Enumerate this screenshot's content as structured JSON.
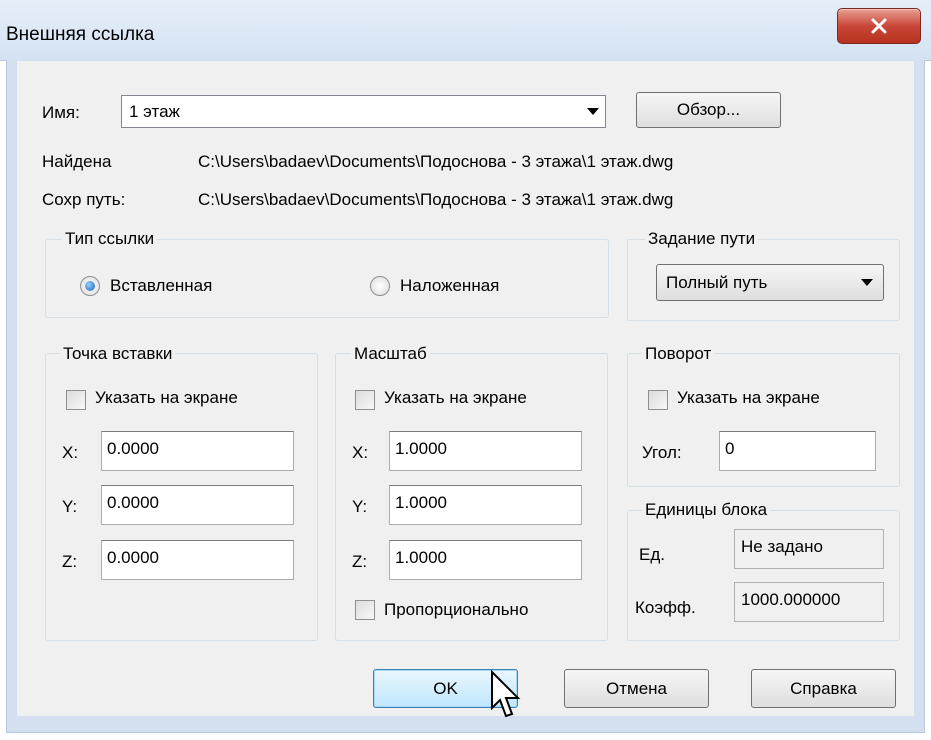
{
  "window": {
    "title": "Внешняя ссылка"
  },
  "name": {
    "label": "Имя:",
    "value": "1 этаж",
    "browse_label": "Обзор..."
  },
  "found": {
    "label": "Найдена",
    "path": "C:\\Users\\badaev\\Documents\\Подоснова - 3 этажа\\1 этаж.dwg"
  },
  "saved": {
    "label": "Сохр путь:",
    "path": "C:\\Users\\badaev\\Documents\\Подоснова - 3 этажа\\1 этаж.dwg"
  },
  "link_type": {
    "title": "Тип ссылки",
    "options": [
      {
        "label": "Вставленная",
        "selected": true
      },
      {
        "label": "Наложенная",
        "selected": false
      }
    ]
  },
  "path_type": {
    "title": "Задание пути",
    "value": "Полный путь"
  },
  "insertion": {
    "title": "Точка вставки",
    "specify_label": "Указать на экране",
    "x_label": "X:",
    "x": "0.0000",
    "y_label": "Y:",
    "y": "0.0000",
    "z_label": "Z:",
    "z": "0.0000"
  },
  "scale": {
    "title": "Масштаб",
    "specify_label": "Указать на экране",
    "x_label": "X:",
    "x": "1.0000",
    "y_label": "Y:",
    "y": "1.0000",
    "z_label": "Z:",
    "z": "1.0000",
    "uniform_label": "Пропорционально"
  },
  "rotation": {
    "title": "Поворот",
    "specify_label": "Указать на экране",
    "angle_label": "Угол:",
    "angle": "0"
  },
  "block_units": {
    "title": "Единицы блока",
    "unit_label": "Ед.",
    "unit_value": "Не задано",
    "factor_label": "Коэфф.",
    "factor_value": "1000.000000"
  },
  "buttons": {
    "ok": "OK",
    "cancel": "Отмена",
    "help": "Справка"
  }
}
